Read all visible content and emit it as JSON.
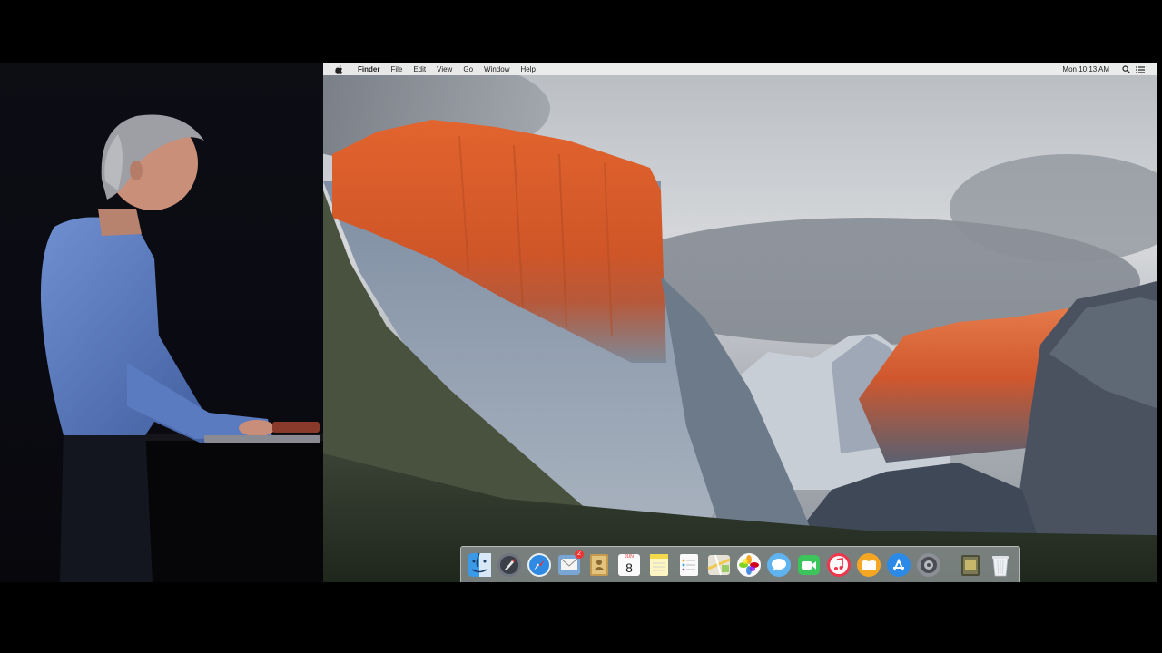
{
  "menubar": {
    "app_name": "Finder",
    "menus": [
      "File",
      "Edit",
      "View",
      "Go",
      "Window",
      "Help"
    ],
    "clock": "Mon 10:13 AM"
  },
  "dock": {
    "items": [
      {
        "name": "Finder",
        "icon": "finder-icon"
      },
      {
        "name": "Launchpad",
        "icon": "launchpad-icon"
      },
      {
        "name": "Safari",
        "icon": "safari-icon"
      },
      {
        "name": "Mail",
        "icon": "mail-icon",
        "badge": "2"
      },
      {
        "name": "Contacts",
        "icon": "contacts-icon"
      },
      {
        "name": "Calendar",
        "icon": "calendar-icon",
        "month": "JUN",
        "day": "8"
      },
      {
        "name": "Notes",
        "icon": "notes-icon"
      },
      {
        "name": "Reminders",
        "icon": "reminders-icon"
      },
      {
        "name": "Maps",
        "icon": "maps-icon"
      },
      {
        "name": "Photos",
        "icon": "photos-icon"
      },
      {
        "name": "Messages",
        "icon": "messages-icon"
      },
      {
        "name": "FaceTime",
        "icon": "facetime-icon"
      },
      {
        "name": "iTunes",
        "icon": "itunes-icon"
      },
      {
        "name": "iBooks",
        "icon": "ibooks-icon"
      },
      {
        "name": "App Store",
        "icon": "app-store-icon"
      },
      {
        "name": "System Preferences",
        "icon": "system-preferences-icon"
      },
      {
        "name": "Downloads",
        "icon": "downloads-stack-icon"
      },
      {
        "name": "Trash",
        "icon": "trash-icon"
      }
    ]
  },
  "colors": {
    "menubar_bg": "#ececec",
    "dock_bg": "#bec4ca",
    "stage_bg": "#0a0a12",
    "rock_glow": "#d8552a"
  }
}
